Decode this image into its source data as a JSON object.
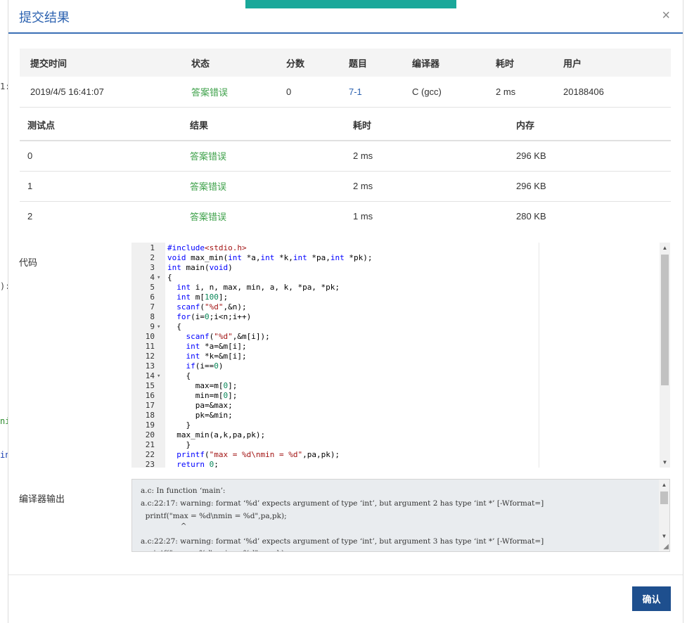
{
  "background_fragments": [
    {
      "text": "1:"
    },
    {
      "text": "):"
    },
    {
      "text": "ni"
    },
    {
      "text": "in"
    }
  ],
  "modal": {
    "title": "提交结果",
    "close_icon": "×",
    "confirm_label": "确认"
  },
  "submission": {
    "headers": [
      "提交时间",
      "状态",
      "分数",
      "题目",
      "编译器",
      "耗时",
      "用户"
    ],
    "row": {
      "time": "2019/4/5 16:41:07",
      "status": "答案错误",
      "score": "0",
      "problem": "7-1",
      "compiler": "C (gcc)",
      "duration": "2 ms",
      "user": "20188406"
    }
  },
  "testcases": {
    "headers": [
      "测试点",
      "结果",
      "耗时",
      "内存"
    ],
    "rows": [
      {
        "id": "0",
        "result": "答案错误",
        "time": "2 ms",
        "memory": "296 KB"
      },
      {
        "id": "1",
        "result": "答案错误",
        "time": "2 ms",
        "memory": "296 KB"
      },
      {
        "id": "2",
        "result": "答案错误",
        "time": "1 ms",
        "memory": "280 KB"
      }
    ]
  },
  "code_label": "代码",
  "compiler_output_label": "编译器输出",
  "code_lines": [
    {
      "n": "1",
      "fold": "",
      "text": "#include<stdio.h>"
    },
    {
      "n": "2",
      "fold": "",
      "text": "void max_min(int *a,int *k,int *pa,int *pk);"
    },
    {
      "n": "3",
      "fold": "",
      "text": "int main(void)"
    },
    {
      "n": "4",
      "fold": "▾",
      "text": "{"
    },
    {
      "n": "5",
      "fold": "",
      "text": "  int i, n, max, min, a, k, *pa, *pk;"
    },
    {
      "n": "6",
      "fold": "",
      "text": "  int m[100];"
    },
    {
      "n": "7",
      "fold": "",
      "text": "  scanf(\"%d\",&n);"
    },
    {
      "n": "8",
      "fold": "",
      "text": "  for(i=0;i<n;i++)"
    },
    {
      "n": "9",
      "fold": "▾",
      "text": "  {"
    },
    {
      "n": "10",
      "fold": "",
      "text": "    scanf(\"%d\",&m[i]);"
    },
    {
      "n": "11",
      "fold": "",
      "text": "    int *a=&m[i];"
    },
    {
      "n": "12",
      "fold": "",
      "text": "    int *k=&m[i];"
    },
    {
      "n": "13",
      "fold": "",
      "text": "    if(i==0)"
    },
    {
      "n": "14",
      "fold": "▾",
      "text": "    {"
    },
    {
      "n": "15",
      "fold": "",
      "text": "      max=m[0];"
    },
    {
      "n": "16",
      "fold": "",
      "text": "      min=m[0];"
    },
    {
      "n": "17",
      "fold": "",
      "text": "      pa=&max;"
    },
    {
      "n": "18",
      "fold": "",
      "text": "      pk=&min;"
    },
    {
      "n": "19",
      "fold": "",
      "text": "    }"
    },
    {
      "n": "20",
      "fold": "",
      "text": "  max_min(a,k,pa,pk);"
    },
    {
      "n": "21",
      "fold": "",
      "text": "    }"
    },
    {
      "n": "22",
      "fold": "",
      "text": "  printf(\"max = %d\\nmin = %d\",pa,pk);"
    },
    {
      "n": "23",
      "fold": "",
      "text": "  return 0;"
    }
  ],
  "compiler_output_lines": [
    "a.c: In function ‘main’:",
    "a.c:22:17: warning: format ‘%d’ expects argument of type ‘int’, but argument 2 has type ‘int *’ [-Wformat=]",
    "  printf(\"max = %d\\nmin = %d\",pa,pk);",
    "                 ^",
    "a.c:22:27: warning: format ‘%d’ expects argument of type ‘int’, but argument 3 has type ‘int *’ [-Wformat=]",
    "  printf(\"max = %d\\nmin = %d\",pa,pk);"
  ],
  "icons": {
    "close": "close-icon",
    "fold": "chevron-down-icon",
    "scroll_up": "triangle-up-icon",
    "scroll_down": "triangle-down-icon",
    "resize": "resize-grip-icon"
  },
  "colors": {
    "accent": "#1aa89a",
    "title": "#2c62b0",
    "status_wrong": "#3ea14a",
    "confirm_bg": "#1e4f8e"
  }
}
